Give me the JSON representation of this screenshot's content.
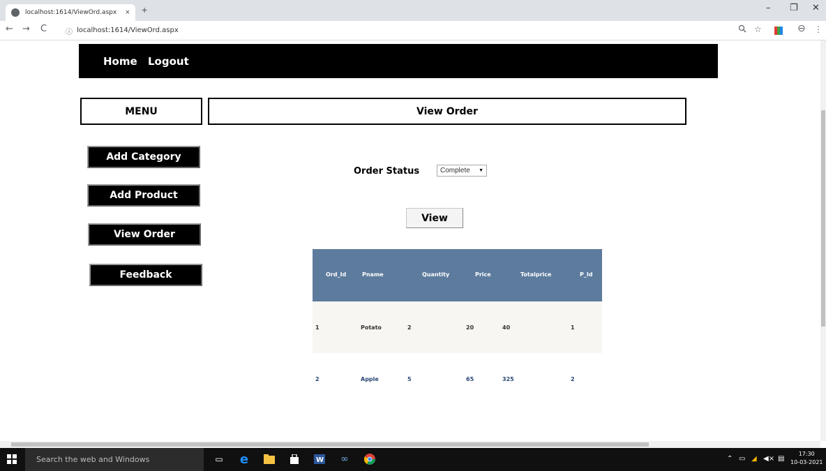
{
  "browser": {
    "tab_title": "localhost:1614/ViewOrd.aspx",
    "tab_close": "×",
    "new_tab": "+",
    "minimize": "–",
    "restore": "❐",
    "close": "✕",
    "back": "←",
    "forward": "→",
    "reload": "C",
    "info": "ⓘ",
    "url": "localhost:1614/ViewOrd.aspx",
    "zoom_icon": "zoom-icon",
    "star": "☆",
    "account": "⊖",
    "more": "⋮"
  },
  "nav": {
    "home": "Home",
    "logout": "Logout"
  },
  "menu_heading": "MENU",
  "page_title": "View Order",
  "sidebar": {
    "items": [
      {
        "label": "Add Category"
      },
      {
        "label": "Add Product"
      },
      {
        "label": "View Order"
      },
      {
        "label": "Feedback"
      }
    ]
  },
  "filter": {
    "label": "Order Status",
    "selected": "Complete",
    "arrow": "▼"
  },
  "view_button": "View",
  "table": {
    "headers": [
      "Ord_Id",
      "Pname",
      "Quantity",
      "Price",
      "Totalprice",
      "P_Id"
    ],
    "rows": [
      [
        "1",
        "Potato",
        "2",
        "20",
        "40",
        "1"
      ],
      [
        "2",
        "Apple",
        "5",
        "65",
        "325",
        "2"
      ]
    ]
  },
  "taskbar": {
    "search_placeholder": "Search the web and Windows",
    "time": "17:30",
    "date": "10-03-2021"
  },
  "colors": {
    "grid_header": "#5d7b9d",
    "grid_odd_row": "#f7f6f3",
    "grid_even_text": "#284775"
  }
}
